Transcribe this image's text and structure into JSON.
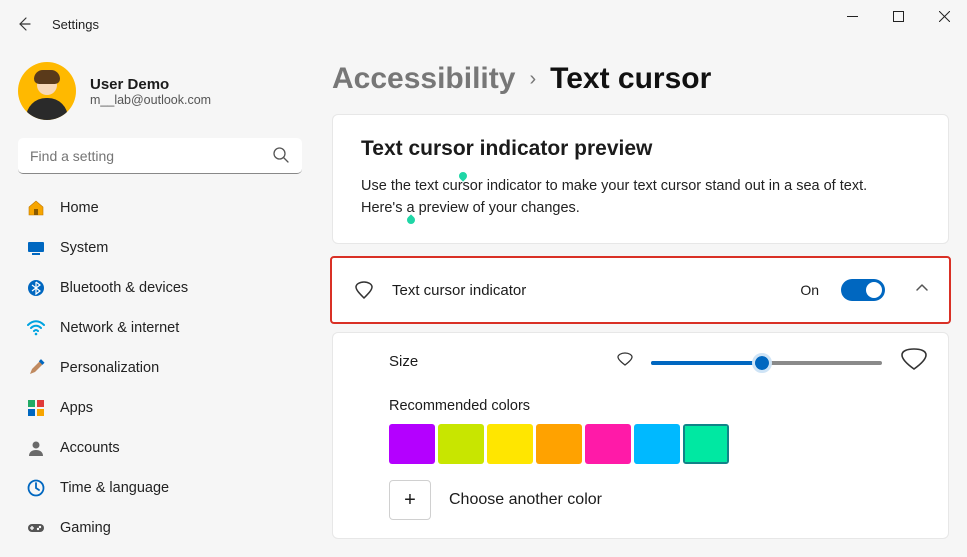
{
  "window": {
    "title": "Settings"
  },
  "profile": {
    "name": "User Demo",
    "email": "m__lab@outlook.com"
  },
  "search": {
    "placeholder": "Find a setting"
  },
  "sidebar": {
    "items": [
      {
        "label": "Home",
        "icon": "home-icon",
        "color": "#f7a500"
      },
      {
        "label": "System",
        "icon": "system-icon",
        "color": "#0067c0"
      },
      {
        "label": "Bluetooth & devices",
        "icon": "bluetooth-icon",
        "color": "#0067c0"
      },
      {
        "label": "Network & internet",
        "icon": "wifi-icon",
        "color": "#00a3e0"
      },
      {
        "label": "Personalization",
        "icon": "brush-icon",
        "color": "#c08a60"
      },
      {
        "label": "Apps",
        "icon": "apps-icon",
        "color": "#2a6"
      },
      {
        "label": "Accounts",
        "icon": "person-icon",
        "color": "#6a6a6a"
      },
      {
        "label": "Time & language",
        "icon": "clock-icon",
        "color": "#0067c0"
      },
      {
        "label": "Gaming",
        "icon": "game-icon",
        "color": "#555"
      }
    ]
  },
  "breadcrumb": {
    "parent": "Accessibility",
    "page": "Text cursor"
  },
  "preview": {
    "heading": "Text cursor indicator preview",
    "text_before": "Use the text ",
    "text_w1": "cursor",
    "text_mid": " indicator to make your text cursor stand out in a sea of text. Here's ",
    "text_w2": "a",
    "text_after": " preview of your changes."
  },
  "indicator": {
    "label": "Text cursor indicator",
    "state": "On"
  },
  "size": {
    "label": "Size",
    "percent": 48
  },
  "colors": {
    "heading": "Recommended colors",
    "swatches": [
      "#b400ff",
      "#c8e600",
      "#ffe600",
      "#ffa200",
      "#ff1aa8",
      "#00b9ff",
      "#00e8a2"
    ],
    "selected_index": 6,
    "choose_label": "Choose another color"
  }
}
